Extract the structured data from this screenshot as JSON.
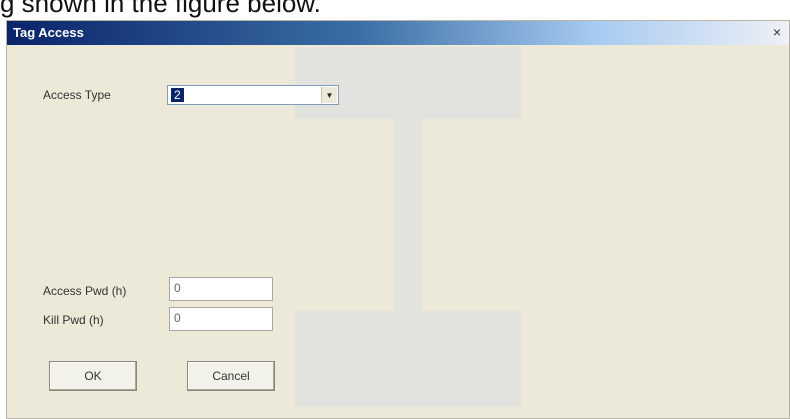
{
  "caption": "g shown in the figure below.",
  "dialog": {
    "title": "Tag Access",
    "close_label": "×",
    "access_type": {
      "label": "Access Type",
      "value": "2"
    },
    "access_pwd": {
      "label": "Access Pwd (h)",
      "value": "0"
    },
    "kill_pwd": {
      "label": "Kill Pwd (h)",
      "value": "0"
    },
    "ok_label": "OK",
    "cancel_label": "Cancel"
  },
  "colors": {
    "titlebar_start": "#0a246a",
    "titlebar_end": "#eef0f6",
    "dialog_bg": "#ece9d8",
    "selection_bg": "#0a246a"
  }
}
